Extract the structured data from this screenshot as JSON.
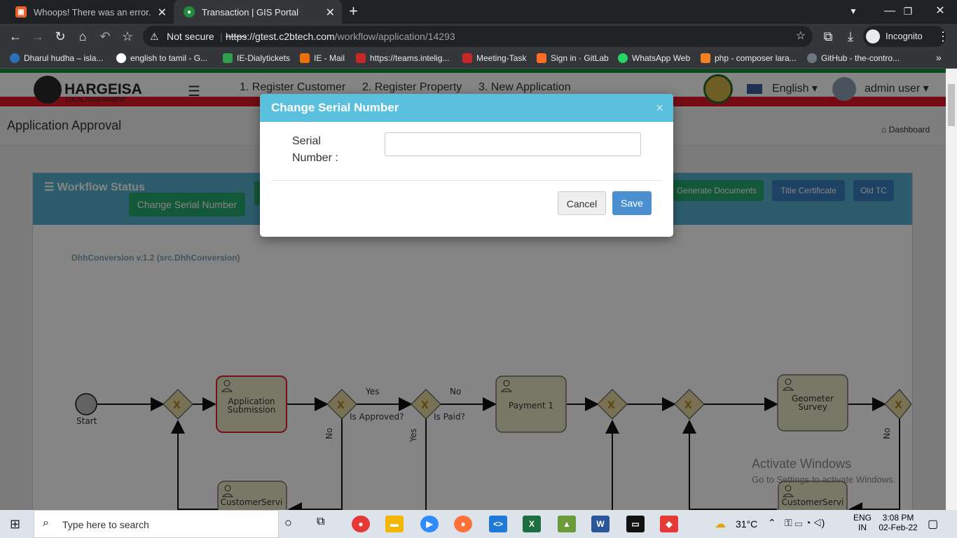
{
  "browser": {
    "tabs": [
      {
        "title": "Whoops! There was an error.",
        "active": false
      },
      {
        "title": "Transaction | GIS Portal",
        "active": true
      }
    ],
    "new_tab": "+",
    "url_warning": "Not secure",
    "url_scheme": "https",
    "url_domain": "://gtest.c2btech.com",
    "url_path": "/workflow/application/14293",
    "incognito_label": "Incognito",
    "bookmarks": [
      {
        "label": "Dharul hudha – isla...",
        "color": "#2c6fbb"
      },
      {
        "label": "english to tamil - G...",
        "color": "#ffffff"
      },
      {
        "label": "IE-Dialytickets",
        "color": "#2e9e4f"
      },
      {
        "label": "IE - Mail",
        "color": "#e8710a"
      },
      {
        "label": "https://teams.intelig...",
        "color": "#c62828"
      },
      {
        "label": "Meeting-Task",
        "color": "#c62828"
      },
      {
        "label": "Sign in · GitLab",
        "color": "#fc6d26"
      },
      {
        "label": "WhatsApp Web",
        "color": "#25d366"
      },
      {
        "label": "php - composer lara...",
        "color": "#f48024"
      },
      {
        "label": "GitHub - the-contro...",
        "color": "#6e7681"
      }
    ],
    "more": "»"
  },
  "app": {
    "brand": "HARGEISA",
    "brand_sub": "LOCAL GOVERNMENT",
    "nav": [
      "1. Register Customer",
      "2. Register Property",
      "3. New Application"
    ],
    "language": "English",
    "user": "admin user",
    "page_title": "Application Approval",
    "breadcrumb": "Dashboard",
    "panel_title": "Workflow Status",
    "buttons": {
      "change_serial": "Change Serial Number",
      "generate_docs": "Generate Documents",
      "title_cert": "Title Certificate",
      "old_tc": "Old TC"
    },
    "process_label": "DhhConversion v.1.2 (src.DhhConversion)",
    "watermark_title": "Activate Windows",
    "watermark_sub": "Go to Settings to activate Windows."
  },
  "workflow": {
    "start": "Start",
    "tasks": {
      "app_submission": "Application Submission",
      "payment": "Payment 1",
      "geometer": "Geometer Survey",
      "cs_app": "CustomerService_Application",
      "cs_geo": "CustomerService_GeometerS"
    },
    "gateways": {
      "approved": "Is Approved?",
      "paid": "Is Paid?"
    },
    "edge_labels": {
      "yes1": "Yes",
      "no1": "No",
      "no2": "No",
      "yes2": "Yes",
      "no3": "No"
    }
  },
  "modal": {
    "title": "Change Serial Number",
    "close": "×",
    "field_label_1": "Serial",
    "field_label_2": "Number :",
    "field_value": "",
    "cancel": "Cancel",
    "save": "Save"
  },
  "taskbar": {
    "search_placeholder": "Type here to search",
    "weather": "31°C",
    "lang1": "ENG",
    "lang2": "IN",
    "time": "3:08 PM",
    "date": "02-Feb-22"
  }
}
